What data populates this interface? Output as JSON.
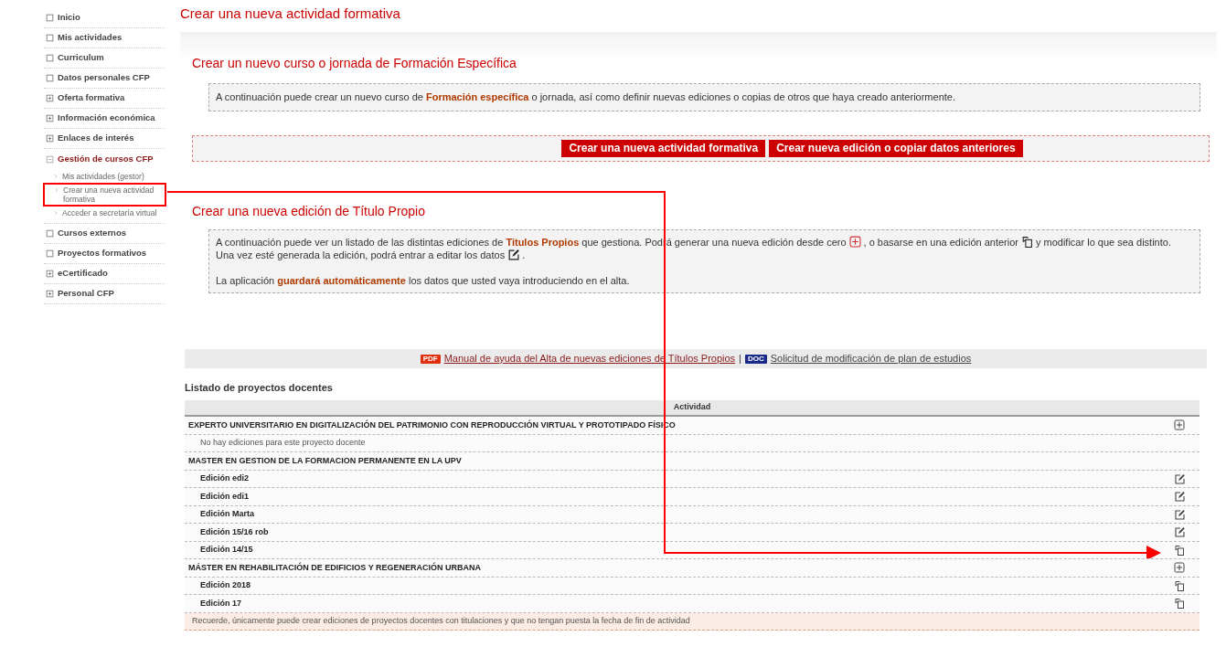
{
  "sidebar": {
    "items": [
      {
        "label": "Inicio",
        "kind": "leaf"
      },
      {
        "label": "Mis actividades",
        "kind": "leaf"
      },
      {
        "label": "Curriculum",
        "kind": "leaf"
      },
      {
        "label": "Datos personales CFP",
        "kind": "leaf"
      },
      {
        "label": "Oferta formativa",
        "kind": "folder",
        "expanded": false
      },
      {
        "label": "Información económica",
        "kind": "folder",
        "expanded": false
      },
      {
        "label": "Enlaces de interés",
        "kind": "folder",
        "expanded": false
      },
      {
        "label": "Gestión de cursos CFP",
        "kind": "folder",
        "expanded": true,
        "children": [
          {
            "label": "Mis actividades (gestor)",
            "highlighted": false
          },
          {
            "label": "Crear una nueva actividad formativa",
            "highlighted": true
          },
          {
            "label": "Acceder a secretaría virtual",
            "highlighted": false
          }
        ]
      },
      {
        "label": "Cursos externos",
        "kind": "leaf"
      },
      {
        "label": "Proyectos formativos",
        "kind": "leaf"
      },
      {
        "label": "eCertificado",
        "kind": "folder",
        "expanded": false
      },
      {
        "label": "Personal CFP",
        "kind": "folder",
        "expanded": false
      }
    ]
  },
  "page_title": "Crear una nueva actividad formativa",
  "specific": {
    "heading": "Crear un nuevo curso o jornada de Formación Específica",
    "info": "A continuación puede crear un nuevo curso de **Formación específica** o jornada, así como definir nuevas ediciones o copias de otros que haya creado anteriormente.",
    "buttons": [
      "Crear una nueva actividad formativa",
      "Crear nueva edición o copiar datos anteriores"
    ]
  },
  "titulo_propio": {
    "heading": "Crear una nueva edición de Título Propio",
    "paragraph_lines": [
      [
        {
          "kind": "text",
          "text": "A continuación puede ver un listado de las distintas ediciones de **Titulos Propios** que gestiona. Podrá generar una nueva edición desde cero"
        },
        {
          "kind": "add_icon"
        },
        {
          "kind": "text",
          "text": ", o basarse en una edición anterior"
        },
        {
          "kind": "copy_icon"
        },
        {
          "kind": "text",
          "text": "y modificar lo que sea distinto."
        }
      ],
      [
        {
          "kind": "text",
          "text": "Una vez esté generada la edición, podrá entrar a editar los datos"
        },
        {
          "kind": "edit_icon"
        },
        {
          "kind": "text",
          "text": "."
        }
      ]
    ],
    "note": "La aplicación **guardará automáticamente** los datos que usted vaya introduciendo en el alta."
  },
  "links": [
    {
      "badge": "PDF",
      "label": "Manual de ayuda del Alta de nuevas ediciones de Títulos Propios"
    },
    {
      "badge": "DOC",
      "label": "Solicitud de modificación de plan de estudios"
    }
  ],
  "links_separator": "|",
  "table": {
    "title": "Listado de proyectos docentes",
    "columns": [
      "Actividad"
    ],
    "rows": [
      {
        "kind": "project_add",
        "text": "EXPERTO UNIVERSITARIO EN DIGITALIZACIÓN DEL PATRIMONIO CON REPRODUCCIÓN VIRTUAL Y PROTOTIPADO FÍSICO"
      },
      {
        "kind": "empty",
        "text": "No hay ediciones para este proyecto docente"
      },
      {
        "kind": "project",
        "text": "MASTER EN GESTION DE LA FORMACION PERMANENTE EN LA UPV"
      },
      {
        "kind": "edition_edit",
        "text": "Edición edi2"
      },
      {
        "kind": "edition_edit",
        "text": "Edición edi1"
      },
      {
        "kind": "edition_edit",
        "text": "Edición Marta"
      },
      {
        "kind": "edition_edit",
        "text": "Edición 15/16 rob"
      },
      {
        "kind": "edition_copy",
        "text": "Edición 14/15"
      },
      {
        "kind": "project_add",
        "text": "MÁSTER EN REHABILITACIÓN DE EDIFICIOS Y REGENERACIÓN URBANA"
      },
      {
        "kind": "edition_copy",
        "text": "Edición 2018"
      },
      {
        "kind": "edition_copy",
        "text": "Edición 17"
      }
    ],
    "footer_note": "Recuerde, únicamente puede crear ediciones de proyectos docentes con titulaciones y que no tengan puesta la fecha de fin de actividad"
  }
}
